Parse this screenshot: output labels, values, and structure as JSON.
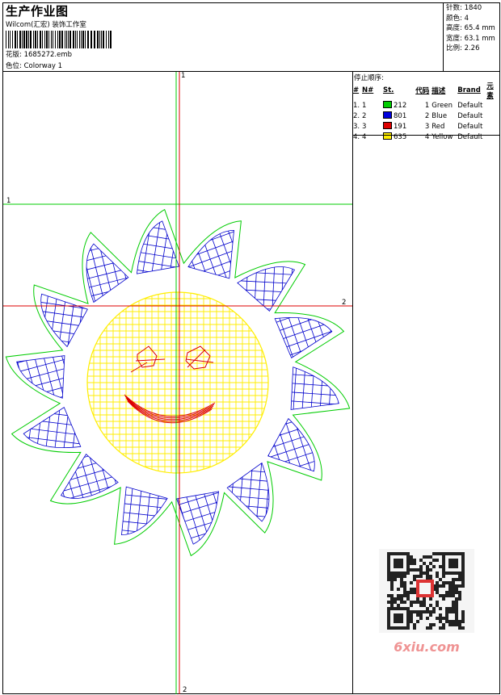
{
  "header": {
    "title": "生产作业图",
    "company": "Wilcom(汇宏) 装饰工作室",
    "design_label": "花版: 1685272.emb",
    "colorway_label": "色位: Colorway 1"
  },
  "stats": {
    "stitches": "针数: 1840",
    "colors": "颜色: 4",
    "height": "高度: 65.4 mm",
    "width": "宽度: 63.1 mm",
    "scale": "比例: 2.26"
  },
  "stop_sequence": {
    "title": "停止顺序:",
    "headers": [
      "#",
      "N#",
      "St.",
      "代码",
      "描述",
      "Brand",
      "元素"
    ],
    "rows": [
      {
        "num": "1.",
        "n": "1",
        "color": "#00cc00",
        "st": "212",
        "code": "1",
        "desc": "Green",
        "brand": "Default"
      },
      {
        "num": "2.",
        "n": "2",
        "color": "#0000dd",
        "st": "801",
        "code": "2",
        "desc": "Blue",
        "brand": "Default"
      },
      {
        "num": "3.",
        "n": "3",
        "color": "#dd0000",
        "st": "191",
        "code": "3",
        "desc": "Red",
        "brand": "Default"
      },
      {
        "num": "4.",
        "n": "4",
        "color": "#ffee00",
        "st": "635",
        "code": "4",
        "desc": "Yellow",
        "brand": "Default"
      }
    ]
  },
  "guides": {
    "top_label": "1",
    "left_label": "1",
    "right_label": "2",
    "bottom_label": "2"
  },
  "watermark": "6xiu.com",
  "colors": {
    "green": "#00cc00",
    "blue": "#0000cc",
    "red": "#dd0000",
    "yellow": "#ffee00"
  }
}
